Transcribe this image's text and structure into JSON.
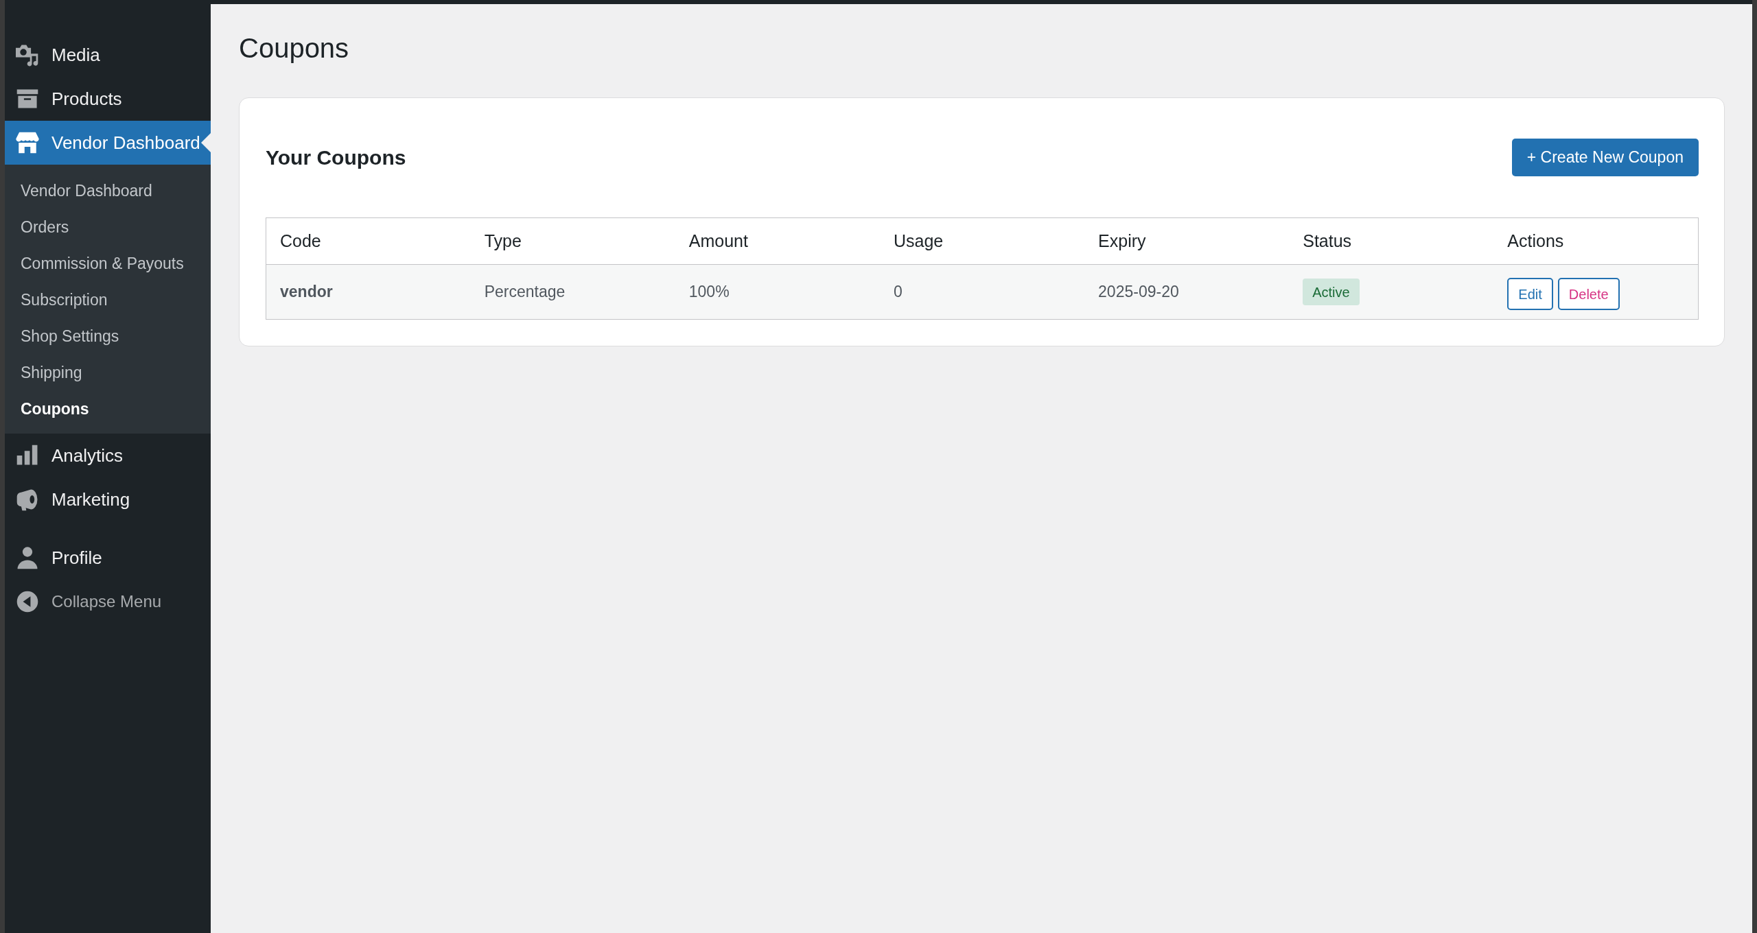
{
  "sidebar": {
    "groups": [
      {
        "items": [
          {
            "label": "Media",
            "selected": false
          },
          {
            "label": "Products",
            "selected": false
          },
          {
            "label": "Vendor Dashboard",
            "selected": true,
            "children": [
              {
                "label": "Vendor Dashboard",
                "selected": false
              },
              {
                "label": "Orders",
                "selected": false
              },
              {
                "label": "Commission & Payouts",
                "selected": false
              },
              {
                "label": "Subscription",
                "selected": false
              },
              {
                "label": "Shop Settings",
                "selected": false
              },
              {
                "label": "Shipping",
                "selected": false
              },
              {
                "label": "Coupons",
                "selected": true
              }
            ]
          },
          {
            "label": "Analytics",
            "selected": false
          },
          {
            "label": "Marketing",
            "selected": false
          }
        ]
      },
      {
        "items": [
          {
            "label": "Profile",
            "selected": false
          }
        ]
      }
    ],
    "collapse_label": "Collapse Menu"
  },
  "page_title": "Coupons",
  "coupons_card": {
    "title": "Your Coupons",
    "create_button": "+ Create New Coupon",
    "table": {
      "columns": [
        "Code",
        "Type",
        "Amount",
        "Usage",
        "Expiry",
        "Status",
        "Actions"
      ],
      "rows": [
        {
          "code": "vendor",
          "type": "Percentage",
          "amount": "100%",
          "usage": "0",
          "expiry": "2025-09-20",
          "status": "Active",
          "actions": [
            {
              "kind": "edit",
              "label": "Edit"
            },
            {
              "kind": "delete",
              "label": "Delete"
            }
          ]
        }
      ]
    }
  }
}
